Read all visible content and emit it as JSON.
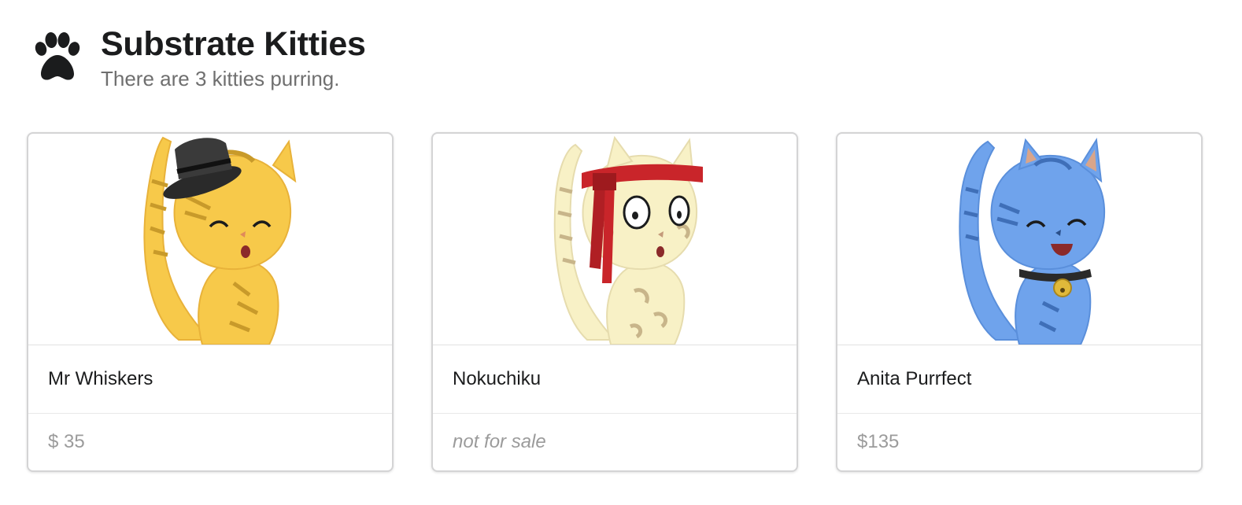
{
  "header": {
    "title": "Substrate Kitties",
    "subtitle": "There are 3 kitties purring.",
    "icon": "paw-icon"
  },
  "kitties": [
    {
      "name": "Mr Whiskers",
      "price": "$ 35",
      "image": "cat-with-top-hat",
      "fur_color": "#f7c94a",
      "stripe_color": "#c89a2a"
    },
    {
      "name": "Nokuchiku",
      "price": "not for sale",
      "image": "cat-with-red-headband",
      "fur_color": "#f8f1c6",
      "stripe_color": "#c8b58a"
    },
    {
      "name": "Anita Purrfect",
      "price": "$135",
      "image": "cat-with-collar-bell",
      "fur_color": "#6fa3ec",
      "stripe_color": "#3f6fb8"
    }
  ]
}
